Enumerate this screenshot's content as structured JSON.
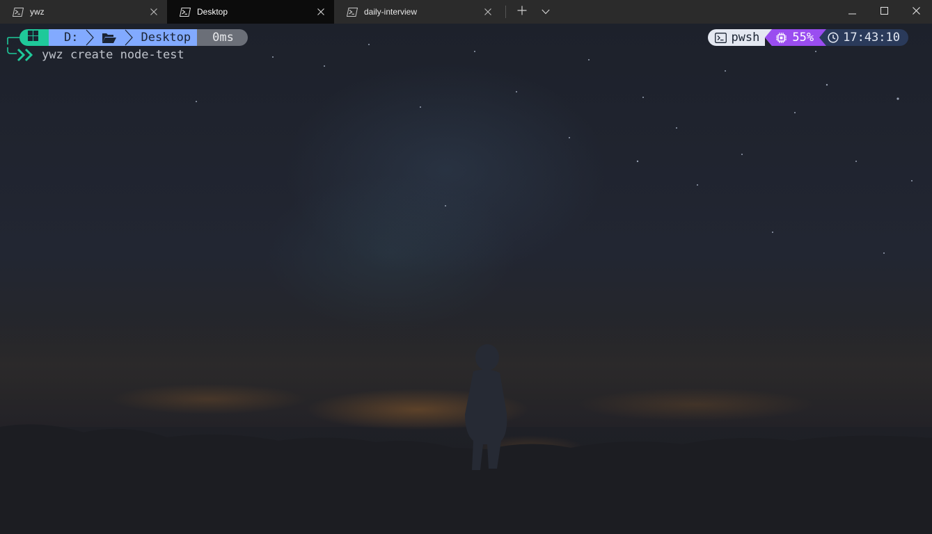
{
  "tabs": [
    {
      "label": "ywz",
      "active": false,
      "icon": "powershell-icon"
    },
    {
      "label": "Desktop",
      "active": true,
      "icon": "powershell-icon"
    },
    {
      "label": "daily-interview",
      "active": false,
      "icon": "powershell-icon"
    }
  ],
  "prompt": {
    "os_segment_icon": "windows-icon",
    "drive": "D:",
    "folder_icon": "folder-open-icon",
    "folder": "Desktop",
    "duration": "0ms",
    "shell": "pwsh",
    "cpu": "55%",
    "time": "17:43:10"
  },
  "command": {
    "text": "ywz create node-test"
  },
  "colors": {
    "os_segment": "#1fc99a",
    "path_segment": "#82aaff",
    "duration_segment": "#6b6f78",
    "shell_segment": "#e4e8f1",
    "cpu_segment": "#9a4df0",
    "time_segment": "#2a3a5a",
    "tab_active": "#0c0c0c",
    "tab_bar": "#2b2b2b"
  }
}
